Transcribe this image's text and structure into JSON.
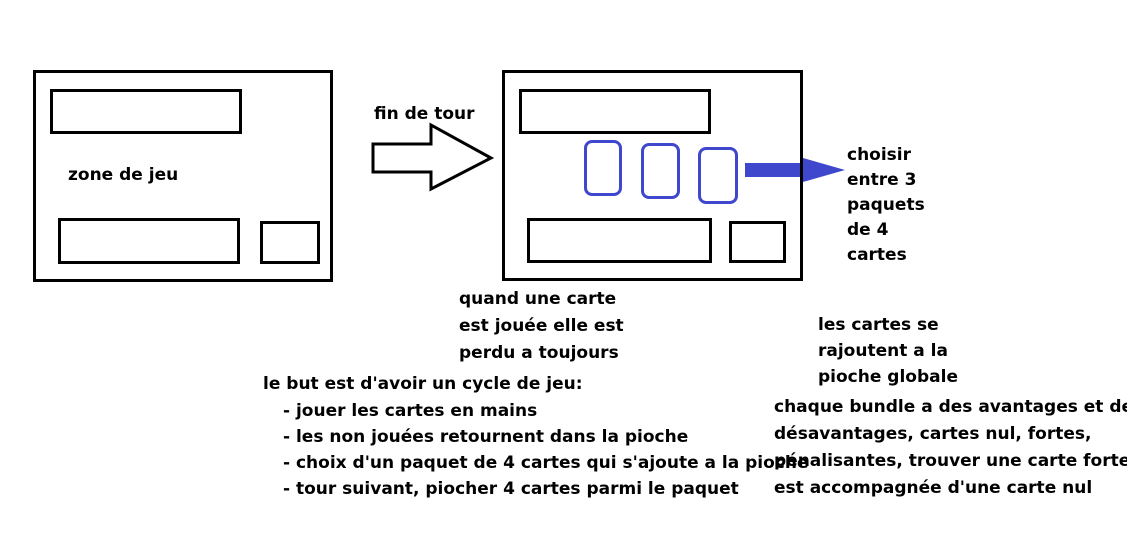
{
  "left_panel": {
    "label": "zone de jeu"
  },
  "transition": {
    "label": "fin de tour"
  },
  "right_panel": {
    "choice_label": [
      "choisir",
      "entre 3",
      "paquets",
      "de 4",
      "cartes"
    ]
  },
  "notes": {
    "played_card": [
      "quand une carte",
      "est jouée elle est",
      "perdu a toujours"
    ],
    "cycle_title": "le but est d'avoir un cycle de jeu:",
    "cycle_steps": [
      "- jouer les cartes en mains",
      "- les non jouées retournent dans la pioche",
      "- choix d'un paquet de 4 cartes qui s'ajoute a la pioche",
      "- tour suivant, piocher 4 cartes parmi le paquet"
    ],
    "global_deck": [
      "les cartes se",
      "rajoutent a la",
      "pioche globale"
    ],
    "bundle": [
      "chaque bundle a des avantages et des",
      "désavantages, cartes nul, fortes,",
      "pénalisantes, trouver une carte forte",
      "est accompagnée d'une carte nul"
    ]
  },
  "colors": {
    "ink": "#000000",
    "accent_blue": "#3f48cc"
  }
}
